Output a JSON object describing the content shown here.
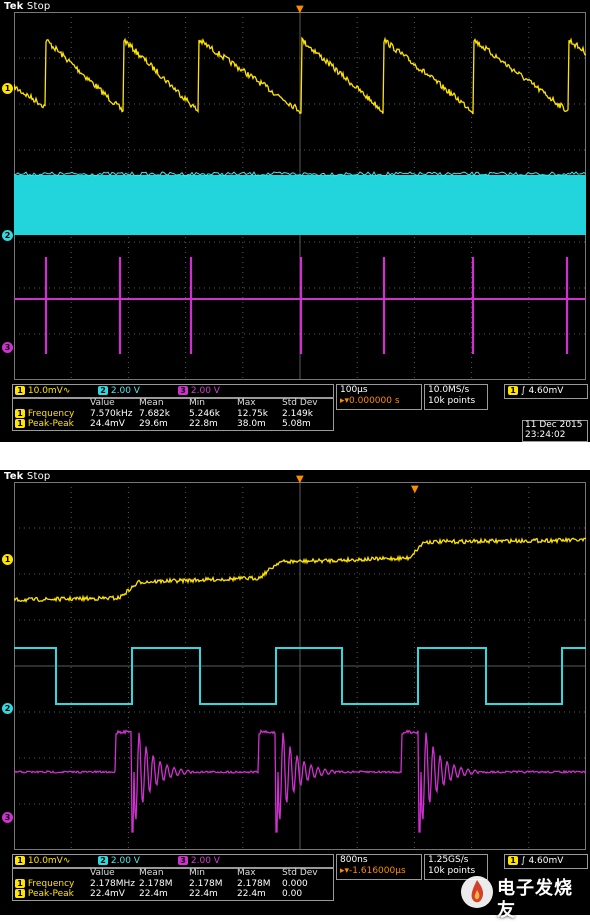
{
  "screenshots": [
    {
      "brand": "Tek",
      "state": "Stop",
      "channel_markers": [
        "1",
        "2",
        "3"
      ],
      "ch1": {
        "scale": "10.0mV",
        "symbol": "∿"
      },
      "ch2": {
        "scale": "2.00 V"
      },
      "ch3": {
        "scale": "2.00 V"
      },
      "timebase": "100µs",
      "trigger_pos": "0.000000 s",
      "sample_rate": "10.0MS/s",
      "record_length": "10k points",
      "trigger": {
        "channel": "1",
        "edge": "rising",
        "level": "4.60mV"
      },
      "date": "11 Dec 2015",
      "time": "23:24:02",
      "measurements": {
        "headers": [
          "Value",
          "Mean",
          "Min",
          "Max",
          "Std Dev"
        ],
        "rows": [
          {
            "channel": "1",
            "name": "Frequency",
            "values": [
              "7.570kHz",
              "7.682k",
              "5.246k",
              "12.75k",
              "2.149k"
            ]
          },
          {
            "channel": "1",
            "name": "Peak-Peak",
            "values": [
              "24.4mV",
              "29.6m",
              "22.8m",
              "38.0m",
              "5.08m"
            ]
          }
        ]
      }
    },
    {
      "brand": "Tek",
      "state": "Stop",
      "channel_markers": [
        "1",
        "2",
        "3"
      ],
      "ch1": {
        "scale": "10.0mV",
        "symbol": "∿"
      },
      "ch2": {
        "scale": "2.00 V"
      },
      "ch3": {
        "scale": "2.00 V"
      },
      "timebase": "800ns",
      "trigger_pos": "-1.616000µs",
      "sample_rate": "1.25GS/s",
      "record_length": "10k points",
      "trigger": {
        "channel": "1",
        "edge": "rising",
        "level": "4.60mV"
      },
      "measurements": {
        "headers": [
          "Value",
          "Mean",
          "Min",
          "Max",
          "Std Dev"
        ],
        "rows": [
          {
            "channel": "1",
            "name": "Frequency",
            "values": [
              "2.178MHz",
              "2.178M",
              "2.178M",
              "2.178M",
              "0.000"
            ]
          },
          {
            "channel": "1",
            "name": "Peak-Peak",
            "values": [
              "22.4mV",
              "22.4m",
              "22.4m",
              "22.4m",
              "0.00"
            ]
          }
        ]
      }
    }
  ],
  "watermark": {
    "text": "电子发烧友",
    "icon": "flame-icon"
  },
  "colors": {
    "ch1": "#ffe400",
    "ch2": "#30d8e0",
    "ch3": "#d030d0",
    "grid": "#6b6b6b",
    "orange": "#ff8c00"
  }
}
